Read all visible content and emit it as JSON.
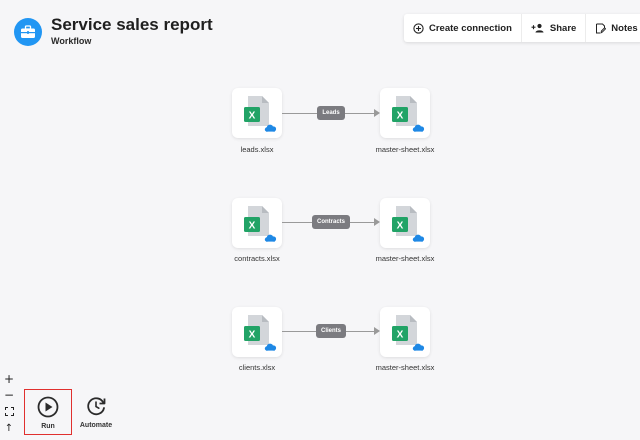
{
  "header": {
    "title": "Service sales report",
    "subtitle": "Workflow",
    "app_icon": "briefcase-icon",
    "accent_color": "#2196f3"
  },
  "toolbar": {
    "create_connection_label": "Create connection",
    "share_label": "Share",
    "notes_label": "Notes"
  },
  "workflow": {
    "rows": [
      {
        "source_label": "leads.xlsx",
        "connection_label": "Leads",
        "target_label": "master-sheet.xlsx"
      },
      {
        "source_label": "contracts.xlsx",
        "connection_label": "Contracts",
        "target_label": "master-sheet.xlsx"
      },
      {
        "source_label": "clients.xlsx",
        "connection_label": "Clients",
        "target_label": "master-sheet.xlsx"
      }
    ],
    "file_icon": "excel-file-icon",
    "cloud_icon": "cloud-icon",
    "excel_color": "#21a366",
    "cloud_color": "#1e88e5"
  },
  "zoom_controls": {
    "zoom_in": "+",
    "zoom_out": "−",
    "fit": "⛶",
    "reset": "↑"
  },
  "actions": {
    "run_label": "Run",
    "automate_label": "Automate"
  }
}
